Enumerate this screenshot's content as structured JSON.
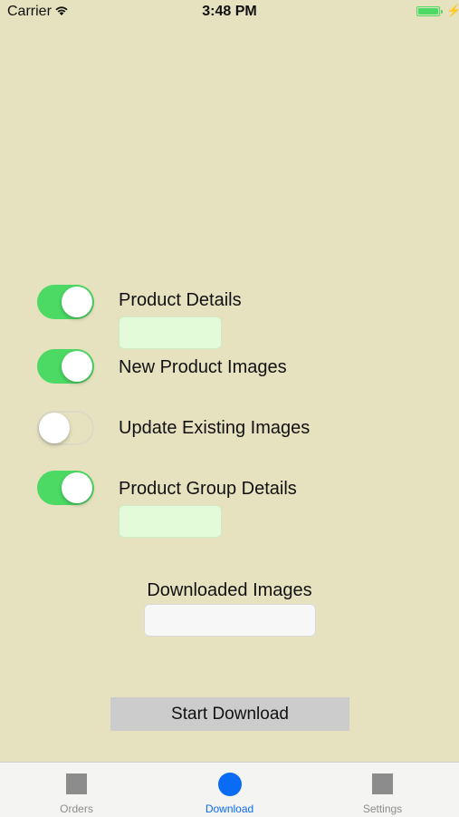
{
  "status": {
    "carrier": "Carrier",
    "time": "3:48 PM"
  },
  "options": [
    {
      "label": "Product Details",
      "on": true
    },
    {
      "label": "New Product Images",
      "on": true
    },
    {
      "label": "Update Existing Images",
      "on": false
    },
    {
      "label": "Product Group Details",
      "on": true
    }
  ],
  "fields": {
    "product_details_value": "",
    "product_group_details_value": ""
  },
  "downloaded": {
    "label": "Downloaded Images",
    "value": ""
  },
  "start_button": "Start Download",
  "tabs": [
    {
      "label": "Orders",
      "icon": "square-icon",
      "active": false
    },
    {
      "label": "Download",
      "icon": "circle-icon",
      "active": true
    },
    {
      "label": "Settings",
      "icon": "square-icon",
      "active": false
    }
  ],
  "colors": {
    "toggle_on": "#4cd964",
    "accent": "#0a6cf5",
    "background": "#e6e2c0"
  }
}
